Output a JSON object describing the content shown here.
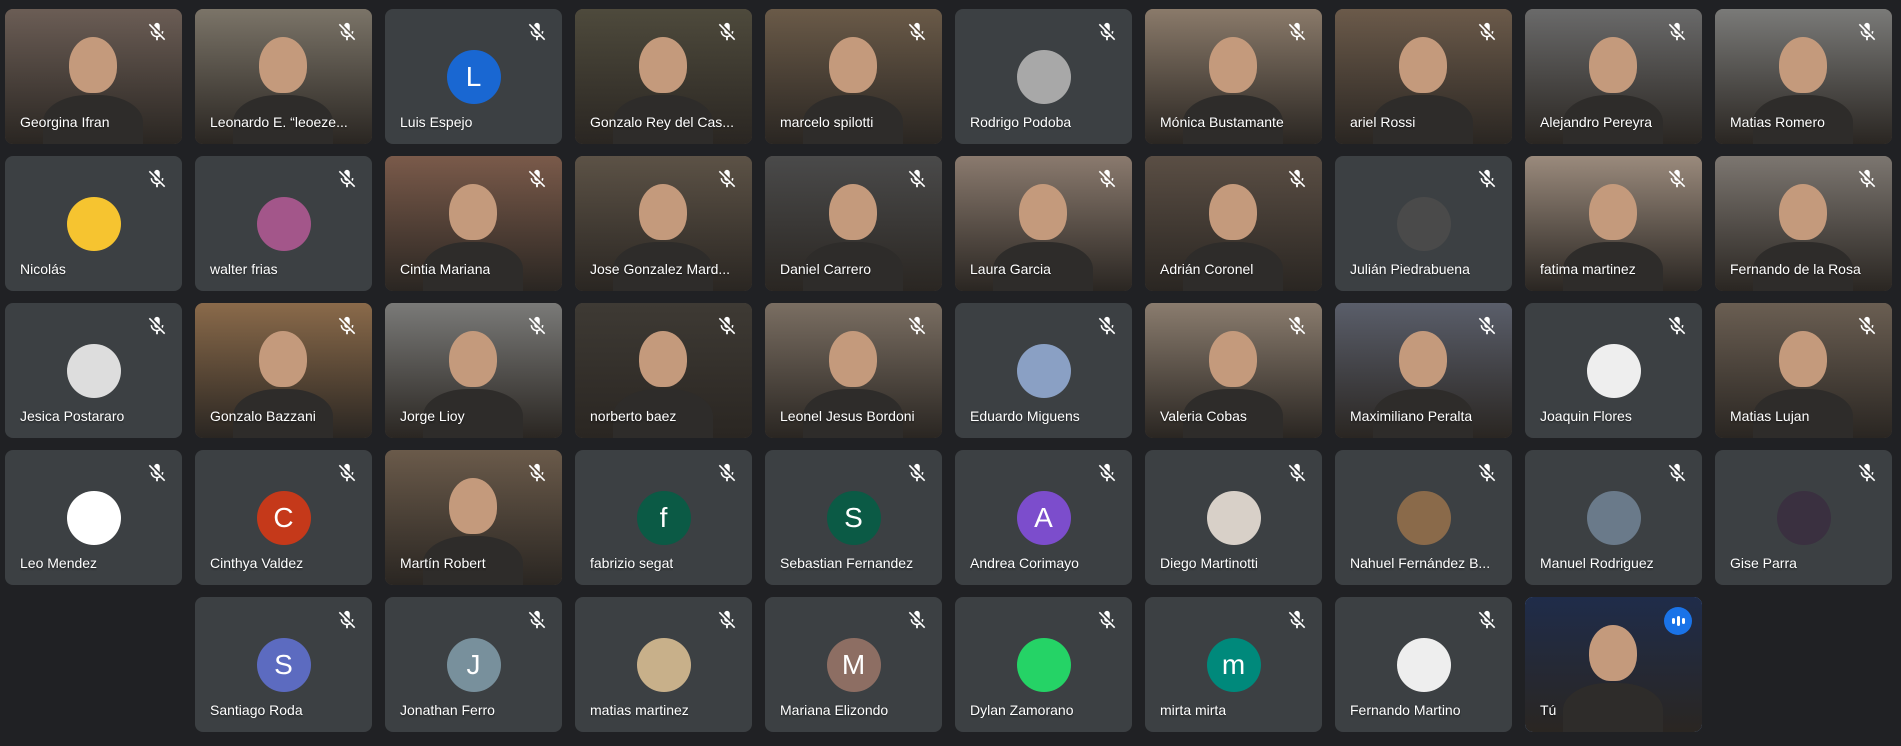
{
  "participants": [
    {
      "name": "Georgina Ifran",
      "type": "video",
      "bg": "#6b5d55"
    },
    {
      "name": "Leonardo E. “leoeze...",
      "type": "video",
      "bg": "#7b7468"
    },
    {
      "name": "Luis Espejo",
      "type": "initial",
      "initial": "L",
      "color": "#1967d2"
    },
    {
      "name": "Gonzalo Rey del Cas...",
      "type": "video",
      "bg": "#4e4a3c"
    },
    {
      "name": "marcelo spilotti",
      "type": "video",
      "bg": "#6a5a48"
    },
    {
      "name": "Rodrigo Podoba",
      "type": "photo",
      "color": "#a8a8a8"
    },
    {
      "name": "Mónica Bustamante",
      "type": "video",
      "bg": "#8a7a6a"
    },
    {
      "name": "ariel Rossi",
      "type": "video",
      "bg": "#6b5a4a"
    },
    {
      "name": "Alejandro Pereyra",
      "type": "video",
      "bg": "#6a6a6a"
    },
    {
      "name": "Matias Romero",
      "type": "video",
      "bg": "#7a7a78"
    },
    {
      "name": "Nicolás",
      "type": "photo",
      "color": "#f6c430"
    },
    {
      "name": "walter frias",
      "type": "photo",
      "color": "#a3568a"
    },
    {
      "name": "Cintia Mariana",
      "type": "video",
      "bg": "#7a5a4a"
    },
    {
      "name": "Jose Gonzalez Mard...",
      "type": "video",
      "bg": "#5c5246"
    },
    {
      "name": "Daniel Carrero",
      "type": "video",
      "bg": "#4a4a4a"
    },
    {
      "name": "Laura Garcia",
      "type": "video",
      "bg": "#8a7a6e"
    },
    {
      "name": "Adrián Coronel",
      "type": "video",
      "bg": "#5a4e44"
    },
    {
      "name": "Julián Piedrabuena",
      "type": "photo",
      "color": "#4a4a4a"
    },
    {
      "name": "fatima martinez",
      "type": "video",
      "bg": "#9a8a7c"
    },
    {
      "name": "Fernando de la Rosa",
      "type": "video",
      "bg": "#7c7670"
    },
    {
      "name": "Jesica Postararo",
      "type": "photo",
      "color": "#dddddd"
    },
    {
      "name": "Gonzalo Bazzani",
      "type": "video",
      "bg": "#8a6a4a"
    },
    {
      "name": "Jorge Lioy",
      "type": "video",
      "bg": "#7a7a78"
    },
    {
      "name": "norberto baez",
      "type": "video",
      "bg": "#3e3a34"
    },
    {
      "name": "Leonel Jesus Bordoni",
      "type": "video",
      "bg": "#7a6e62"
    },
    {
      "name": "Eduardo Miguens",
      "type": "photo",
      "color": "#8aa0c4"
    },
    {
      "name": "Valeria Cobas",
      "type": "video",
      "bg": "#8a7c6e"
    },
    {
      "name": "Maximiliano Peralta",
      "type": "video",
      "bg": "#5a5e6a"
    },
    {
      "name": "Joaquin Flores",
      "type": "photo",
      "color": "#eeeeee"
    },
    {
      "name": "Matias Lujan",
      "type": "video",
      "bg": "#6a5e52"
    },
    {
      "name": "Leo Mendez",
      "type": "photo",
      "color": "#ffffff"
    },
    {
      "name": "Cinthya Valdez",
      "type": "initial",
      "initial": "C",
      "color": "#c5391a"
    },
    {
      "name": "Martín Robert",
      "type": "video",
      "bg": "#6a5a4a"
    },
    {
      "name": "fabrizio segat",
      "type": "initial",
      "initial": "f",
      "color": "#0b5a45"
    },
    {
      "name": "Sebastian Fernandez",
      "type": "initial",
      "initial": "S",
      "color": "#0b5a45"
    },
    {
      "name": "Andrea Corimayo",
      "type": "initial",
      "initial": "A",
      "color": "#7c4dcc"
    },
    {
      "name": "Diego Martinotti",
      "type": "photo",
      "color": "#d8d0c8"
    },
    {
      "name": "Nahuel Fernández B...",
      "type": "photo",
      "color": "#8a6a4a"
    },
    {
      "name": "Manuel Rodriguez",
      "type": "photo",
      "color": "#6a7a8a"
    },
    {
      "name": "Gise Parra",
      "type": "photo",
      "color": "#3a3040"
    },
    {
      "name": "Santiago Roda",
      "type": "initial",
      "initial": "S",
      "color": "#5c6bc0"
    },
    {
      "name": "Jonathan Ferro",
      "type": "initial",
      "initial": "J",
      "color": "#78909c"
    },
    {
      "name": "matias martinez",
      "type": "photo",
      "color": "#c8b08a"
    },
    {
      "name": "Mariana Elizondo",
      "type": "initial",
      "initial": "M",
      "color": "#8d6e63"
    },
    {
      "name": "Dylan Zamorano",
      "type": "photo",
      "color": "#25d366"
    },
    {
      "name": "mirta mirta",
      "type": "initial",
      "initial": "m",
      "color": "#00897b"
    },
    {
      "name": "Fernando Martino",
      "type": "photo",
      "color": "#eeeeee"
    },
    {
      "name": "Tú",
      "type": "video",
      "bg": "#1f2c4a",
      "active": true
    }
  ]
}
